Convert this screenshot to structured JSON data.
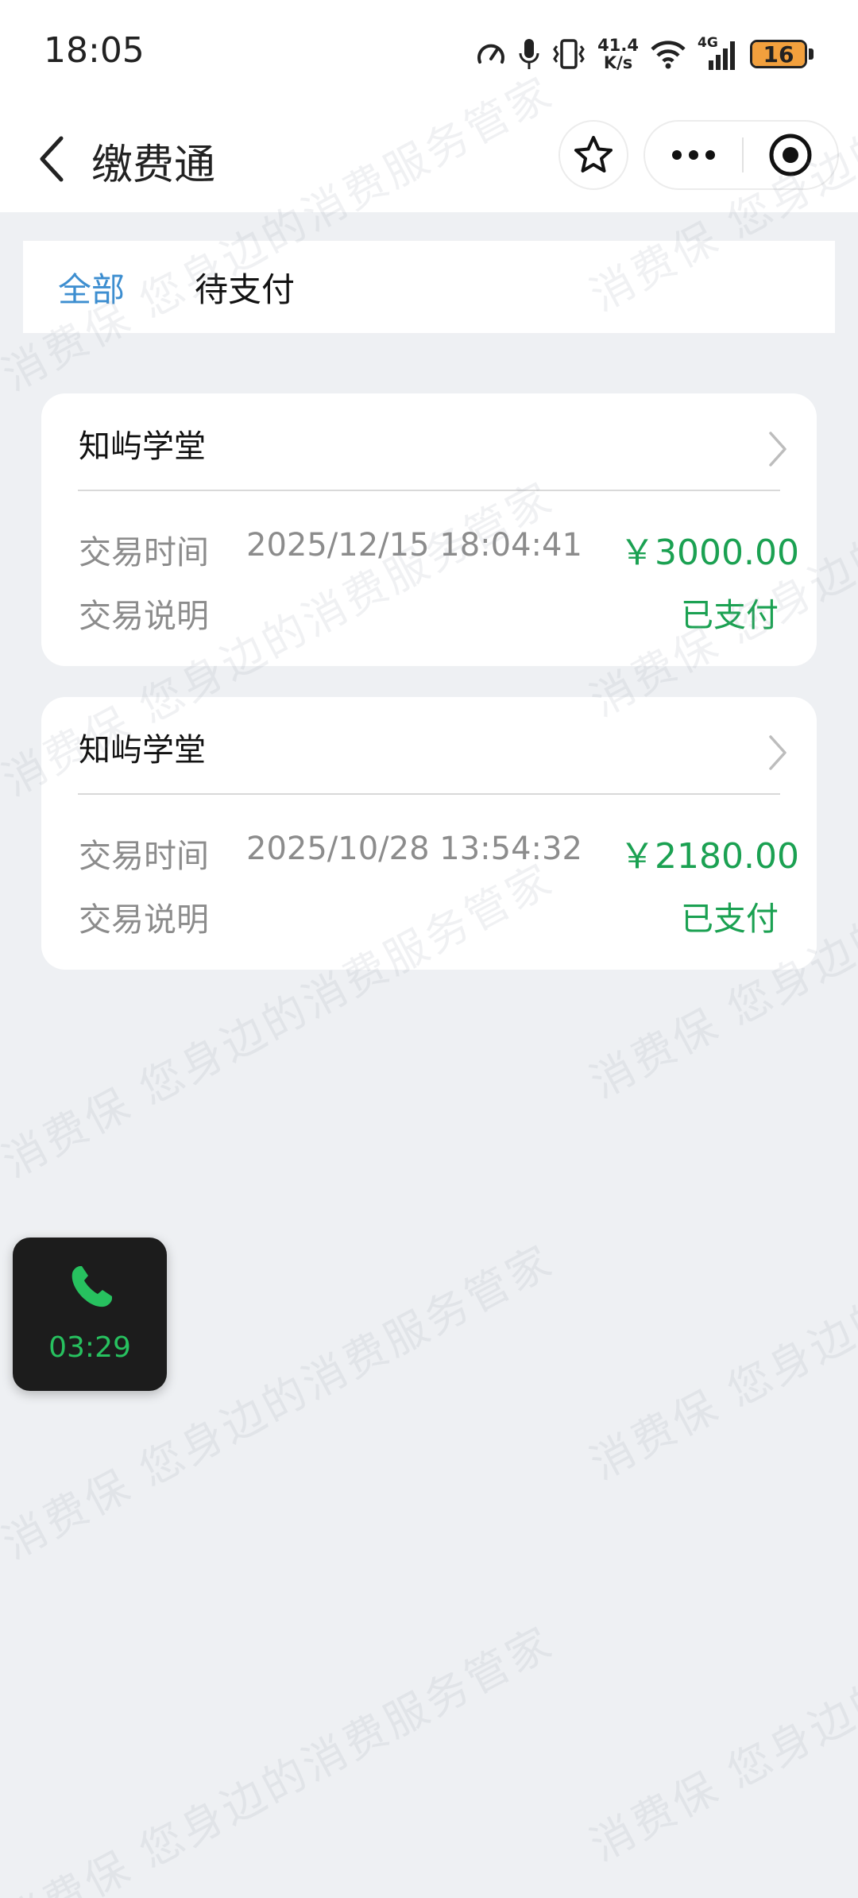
{
  "status_bar": {
    "time": "18:05",
    "net_speed_value": "41.4",
    "net_speed_unit": "K/s",
    "network_type": "4G",
    "battery_level": "16"
  },
  "nav": {
    "title": "缴费通"
  },
  "tabs": [
    {
      "label": "全部",
      "active": true
    },
    {
      "label": "待支付",
      "active": false
    }
  ],
  "orders": [
    {
      "merchant": "知屿学堂",
      "time_label": "交易时间",
      "time": "2025/12/15 18:04:41",
      "amount": "￥3000.00",
      "desc_label": "交易说明",
      "status": "已支付"
    },
    {
      "merchant": "知屿学堂",
      "time_label": "交易时间",
      "time": "2025/10/28 13:54:32",
      "amount": "￥2180.00",
      "desc_label": "交易说明",
      "status": "已支付"
    }
  ],
  "call_widget": {
    "timer": "03:29"
  },
  "watermark": {
    "line_a": "消费保 您身边的消费服务管家"
  },
  "colors": {
    "accent_blue": "#3d8ed0",
    "paid_green": "#1ba152",
    "call_green": "#27c15f",
    "background": "#eef0f3"
  }
}
